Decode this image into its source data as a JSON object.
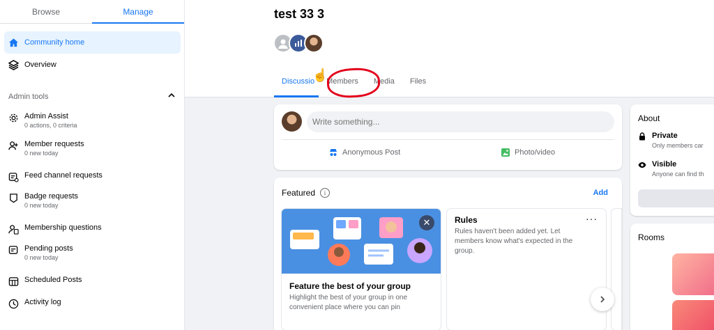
{
  "sidebar": {
    "tabs": [
      {
        "label": "Browse",
        "active": false
      },
      {
        "label": "Manage",
        "active": true
      }
    ],
    "items": [
      {
        "label": "Community home",
        "icon": "home-icon",
        "active": true
      },
      {
        "label": "Overview",
        "icon": "layers-icon",
        "active": false
      }
    ],
    "section": "Admin tools",
    "admin_items": [
      {
        "label": "Admin Assist",
        "sub": "0 actions, 0 criteria",
        "icon": "gear-icon"
      },
      {
        "label": "Member requests",
        "sub": "0 new today",
        "icon": "add-person-icon"
      },
      {
        "label": "Feed channel requests",
        "sub": "",
        "icon": "feed-icon"
      },
      {
        "label": "Badge requests",
        "sub": "0 new today",
        "icon": "badge-icon"
      },
      {
        "label": "Membership questions",
        "sub": "",
        "icon": "questions-icon"
      },
      {
        "label": "Pending posts",
        "sub": "0 new today",
        "icon": "pending-icon"
      },
      {
        "label": "Scheduled Posts",
        "sub": "",
        "icon": "calendar-icon"
      },
      {
        "label": "Activity log",
        "sub": "",
        "icon": "clock-icon"
      }
    ]
  },
  "group": {
    "title": "test 33 3",
    "tabs": [
      {
        "label": "Discussio",
        "active": true
      },
      {
        "label": "Members",
        "active": false
      },
      {
        "label": "Media",
        "active": false
      },
      {
        "label": "Files",
        "active": false
      }
    ]
  },
  "composer": {
    "placeholder": "Write something...",
    "anonymous_label": "Anonymous Post",
    "photo_label": "Photo/video"
  },
  "featured": {
    "title": "Featured",
    "add_label": "Add",
    "promo_title": "Feature the best of your group",
    "promo_body": "Highlight the best of your group in one convenient place where you can pin",
    "rules_title": "Rules",
    "rules_body": "Rules haven't been added yet. Let members know what's expected in the group."
  },
  "about": {
    "title": "About",
    "private_title": "Private",
    "private_sub": "Only members car",
    "visible_title": "Visible",
    "visible_sub": "Anyone can find th"
  },
  "rooms": {
    "title": "Rooms"
  },
  "colors": {
    "accent": "#1877f2",
    "annotation": "#e3001b"
  }
}
